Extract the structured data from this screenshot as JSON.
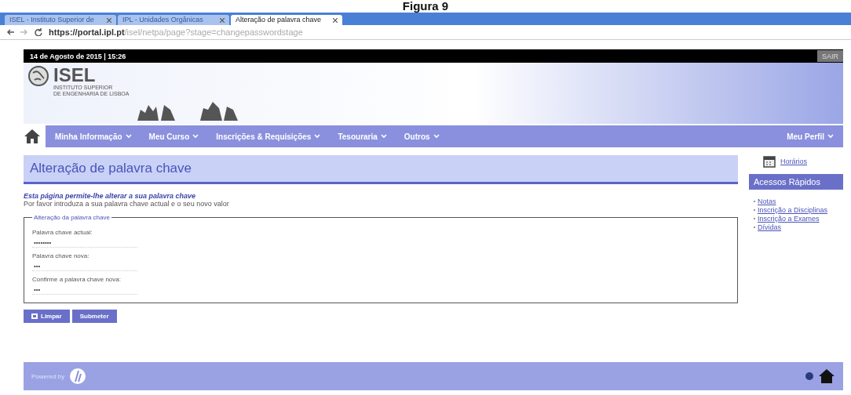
{
  "caption": "Figura 9",
  "browser": {
    "tabs": [
      {
        "title": "ISEL - Instituto Superior de",
        "selected": false
      },
      {
        "title": "IPL - Unidades Orgânicas",
        "selected": false
      },
      {
        "title": "Alteração de palavra chave",
        "selected": true
      }
    ],
    "url_host": "https://portal.ipl.pt",
    "url_path": "/isel/netpa/page?stage=changepasswordstage"
  },
  "top_bar": {
    "date": "14 de Agosto de 2015 | 15:26",
    "logout": "SAIR"
  },
  "logo": {
    "name": "ISEL",
    "subtitle": [
      "INSTITUTO SUPERIOR",
      "DE ENGENHARIA DE LISBOA"
    ]
  },
  "nav": {
    "items": [
      "Minha Informação",
      "Meu Curso",
      "Inscrições & Requisições",
      "Tesouraria",
      "Outros"
    ],
    "profile": "Meu Perfil"
  },
  "page_title": "Alteração de palavra chave",
  "intro": "Esta página permite-lhe alterar a sua palavra chave",
  "instruction": "Por favor introduza a sua palavra chave actual e o seu novo valor",
  "form": {
    "legend": "Alteração da palavra chave",
    "fields": [
      {
        "label": "Palavra chave actual:",
        "value": "••••••••"
      },
      {
        "label": "Palavra chave nova:",
        "value": "•••"
      },
      {
        "label": "Confirme a palavra chave nova:",
        "value": "•••"
      }
    ]
  },
  "buttons": [
    "Limpar",
    "Submeter"
  ],
  "sidebar": {
    "link": "Horários",
    "quick_title": "Acessos Rápidos",
    "quick_links": [
      "Notas",
      "Inscrição a Disciplinas",
      "Inscrição a Exames",
      "Dívidas"
    ]
  },
  "footer": {
    "powered_by": "Powered by"
  }
}
